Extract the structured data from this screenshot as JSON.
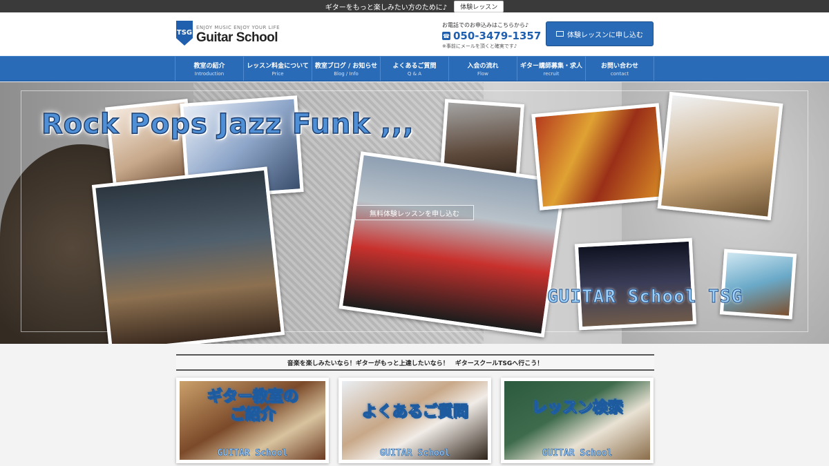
{
  "topbar": {
    "message": "ギターをもっと楽しみたい方のために♪",
    "button": "体験レッスン"
  },
  "header": {
    "logo_mark": "TSG",
    "logo_tagline": "ENJOY MUSIC ENJOY YOUR LIFE",
    "logo_name": "Guitar School",
    "contact_lead": "お電話でのお申込みはこちらから♪",
    "phone": "050-3479-1357",
    "contact_note": "※事前にメールを頂くと確実です♪",
    "apply_button": "体験レッスンに申し込む"
  },
  "nav": [
    {
      "ja": "教室の紹介",
      "en": "Introduction"
    },
    {
      "ja": "レッスン料金について",
      "en": "Price"
    },
    {
      "ja": "教室ブログ / お知らせ",
      "en": "Blog / Info"
    },
    {
      "ja": "よくあるご質問",
      "en": "Q & A"
    },
    {
      "ja": "入会の流れ",
      "en": "Flow"
    },
    {
      "ja": "ギター講師募集・求人",
      "en": "recruit"
    },
    {
      "ja": "お問い合わせ",
      "en": "contact"
    }
  ],
  "hero": {
    "title": "Rock Pops Jazz Funk ,,,",
    "cta": "無料体験レッスンを申し込む",
    "badge": "GUITAR School TSG"
  },
  "tagline": "音楽を楽しみたいなら！ギターがもっと上達したいなら！　ギタースクールTSGへ行こう！",
  "cards": [
    {
      "title_line1": "ギター教室の",
      "title_line2": "ご紹介",
      "brand": "GUITAR School"
    },
    {
      "title_line1": "よくあるご質問",
      "title_line2": "",
      "brand": "GUITAR School"
    },
    {
      "title_line1": "レッスン検索",
      "title_line2": "",
      "brand": "GUITAR School"
    }
  ],
  "colors": {
    "brand_blue": "#2a6bb8",
    "topbar": "#3a3a3a"
  }
}
